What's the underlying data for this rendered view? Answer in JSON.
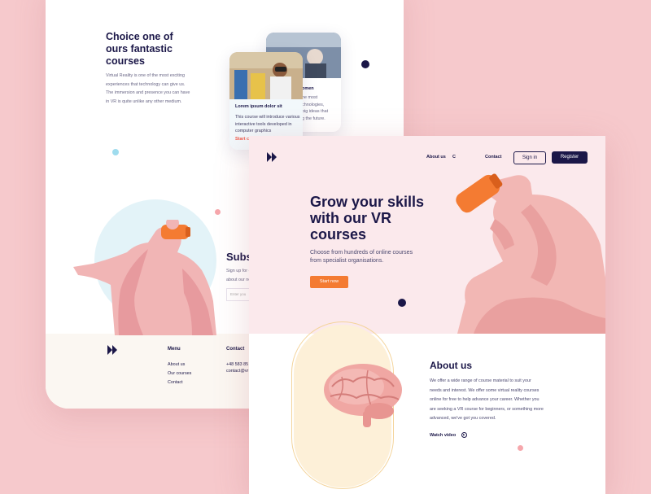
{
  "back_page": {
    "courses_title": "Choice one of ours fantastic courses",
    "courses_body": "Virtual Reality is one of the most exciting experiences that technology can give us. The immersion and presence you can have in VR is quite unlike any other medium.",
    "card_front": {
      "title": "Lorem ipsum dolor sit",
      "body": "This course will introduce various interactive tools developed in computer graphics",
      "link": "Start c"
    },
    "card_back": {
      "title": "omen",
      "body": "he most\nchnologies,\nbig ideas that\ng the future."
    },
    "subscribe_title": "Subs",
    "subscribe_text": "Sign up for c\nabout our ne",
    "subscribe_placeholder": "Enter you",
    "footer": {
      "menu_heading": "Menu",
      "menu_items": [
        "About us",
        "Our courses",
        "Contact"
      ],
      "contact_heading": "Contact",
      "contact_lines": [
        "+48 583 85",
        "contact@vr"
      ]
    }
  },
  "front_page": {
    "nav": {
      "about_us": "About us",
      "item2": "C",
      "contact": "Contact",
      "sign_in": "Sign in",
      "register": "Register"
    },
    "hero": {
      "title": "Grow your skills with our VR courses",
      "subtitle": "Choose from hundreds of online courses from  specialist organisations.",
      "cta": "Start now"
    },
    "about": {
      "title": "About us",
      "body": "We offer a wide range of course material to suit your needs and interest. We offer some virtual reality courses online for free to help advance your career. Whether you are seeking a VR course for beginners, or something more advanced, we've got you covered.",
      "watch_video": "Watch video"
    }
  },
  "colors": {
    "background": "#f6c9cc",
    "navy": "#1b1748",
    "accent_orange": "#f47b32",
    "hero_pink": "#fbe9ec"
  }
}
